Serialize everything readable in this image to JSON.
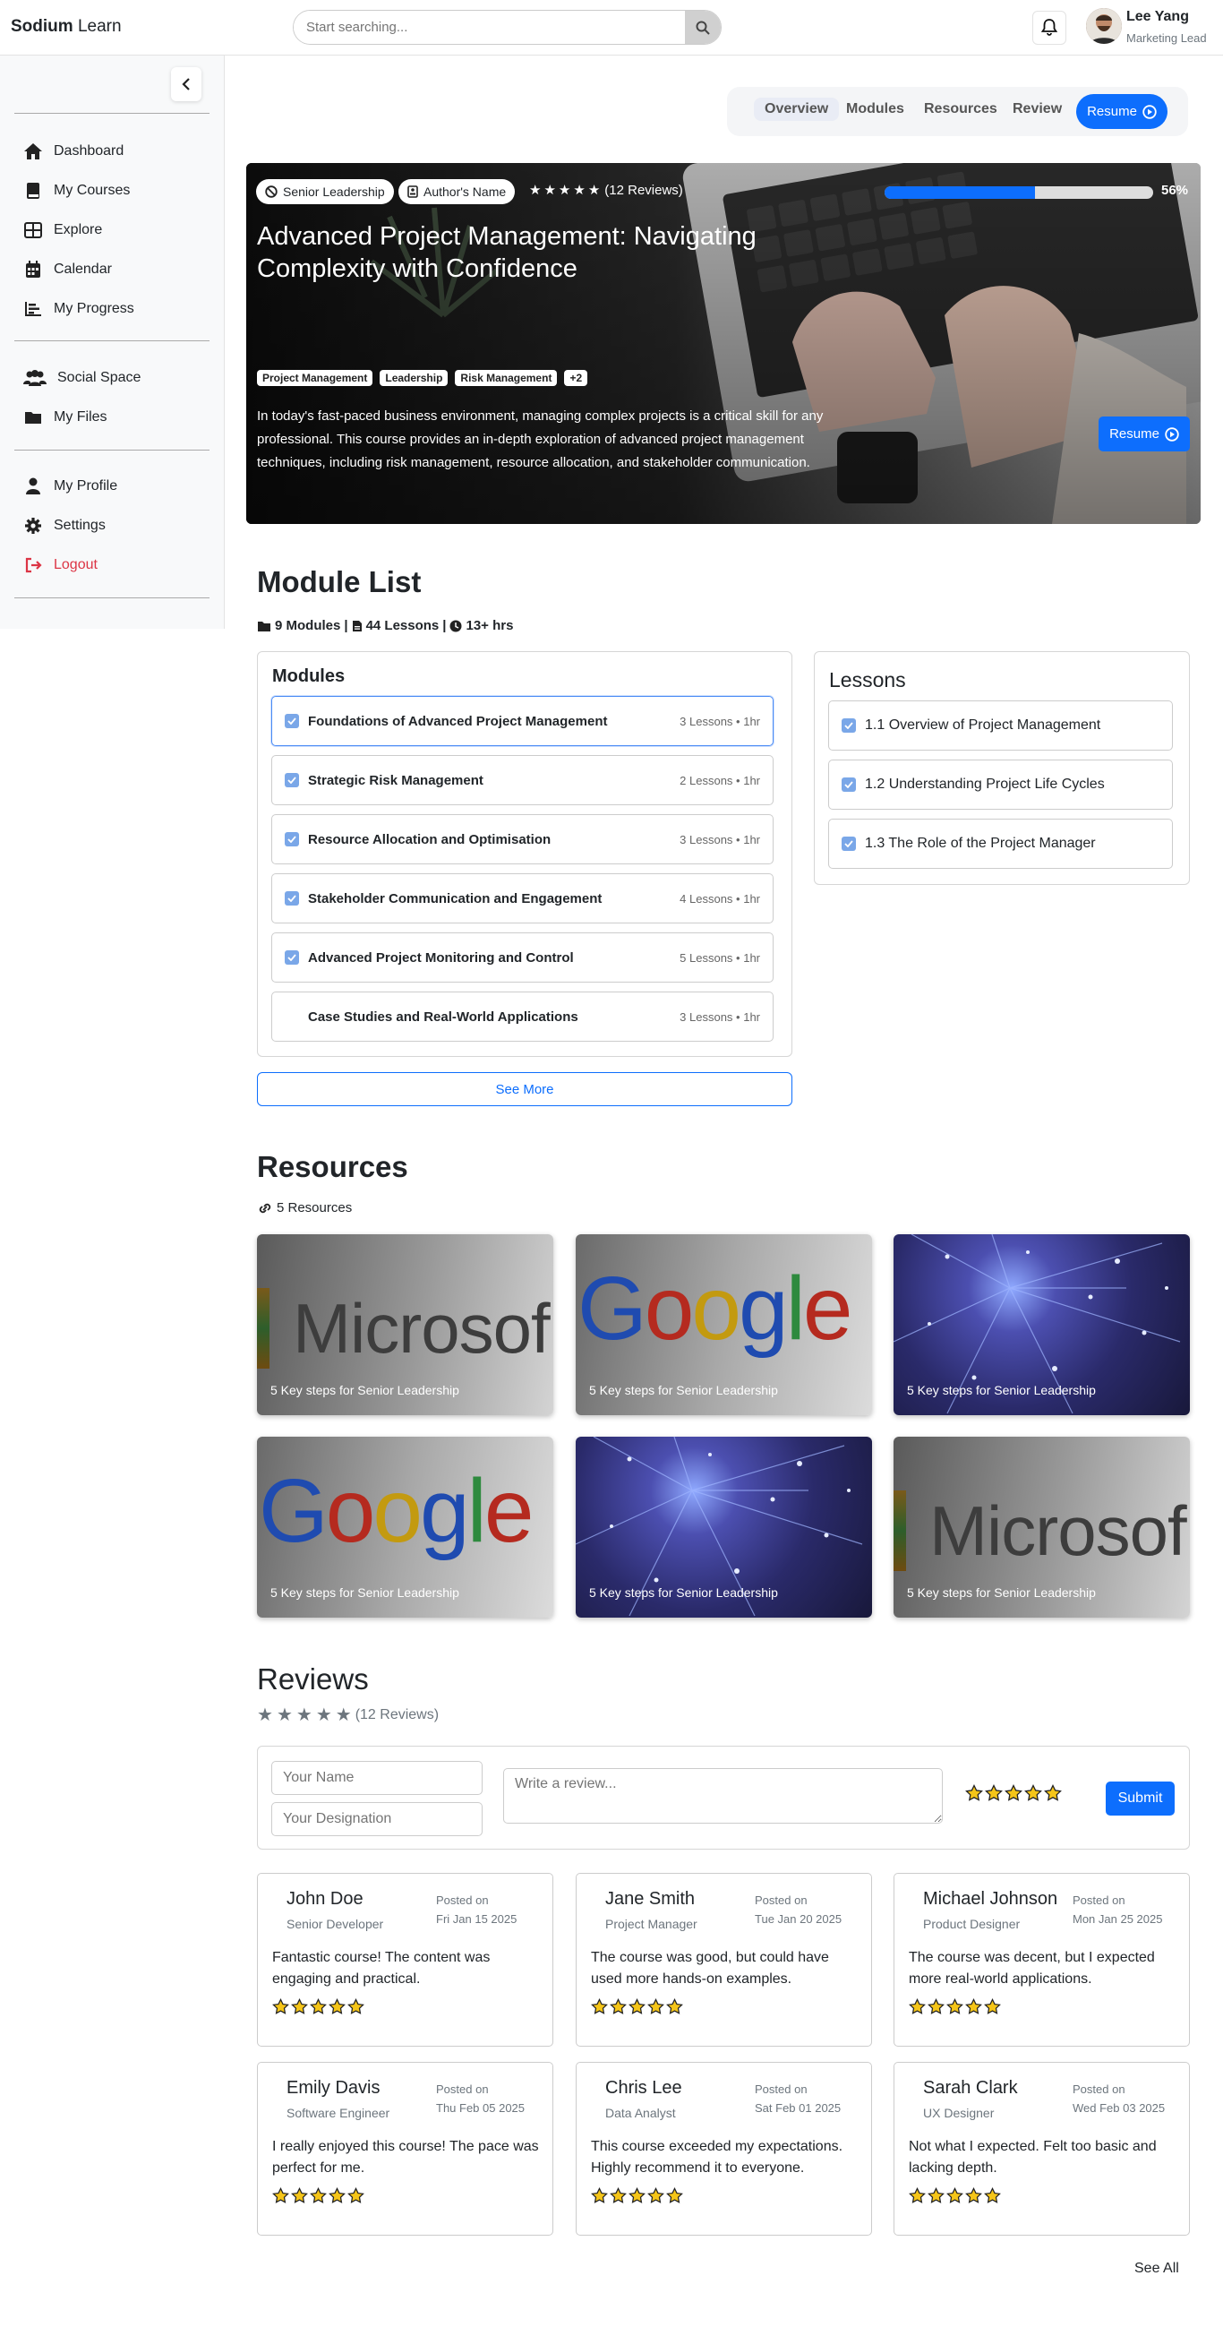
{
  "app": {
    "brand_bold": "Sodium",
    "brand_rest": " Learn"
  },
  "search": {
    "placeholder": "Start searching..."
  },
  "user": {
    "name": "Lee Yang",
    "role": "Marketing Lead"
  },
  "sidebar": {
    "group1": [
      {
        "label": "Dashboard",
        "icon": "home-icon"
      },
      {
        "label": "My Courses",
        "icon": "book-icon"
      },
      {
        "label": "Explore",
        "icon": "grid-icon"
      },
      {
        "label": "Calendar",
        "icon": "calendar-icon"
      },
      {
        "label": "My Progress",
        "icon": "chart-icon"
      }
    ],
    "group2": [
      {
        "label": "Social Space",
        "icon": "users-icon"
      },
      {
        "label": "My Files",
        "icon": "folder-icon"
      }
    ],
    "group3": [
      {
        "label": "My Profile",
        "icon": "user-icon"
      },
      {
        "label": "Settings",
        "icon": "gear-icon"
      },
      {
        "label": "Logout",
        "icon": "logout-icon"
      }
    ]
  },
  "tabs": {
    "overview": "Overview",
    "modules": "Modules",
    "resources": "Resources",
    "review": "Review",
    "resume": "Resume"
  },
  "hero": {
    "chip1": "Senior Leadership",
    "chip2": "Author's Name",
    "reviews": "(12 Reviews)",
    "progress_pct": "56%",
    "progress_value": 0.56,
    "title": "Advanced Project Management: Navigating Complexity with Confidence",
    "tags": [
      "Project Management",
      "Leadership",
      "Risk Management",
      "+2"
    ],
    "description": "In today's fast-paced business environment, managing complex projects is a critical skill for any professional. This course provides an in-depth exploration of advanced project management techniques, including risk management, resource allocation, and stakeholder communication.",
    "resume": "Resume"
  },
  "modules": {
    "heading": "Module List",
    "meta_modules": "9 Modules",
    "meta_lessons": "44 Lessons",
    "meta_hours": "13+ hrs",
    "card_title": "Modules",
    "items": [
      {
        "title": "Foundations of Advanced Project Management",
        "count": "3 Lessons • 1hr"
      },
      {
        "title": "Strategic Risk Management",
        "count": "2 Lessons • 1hr"
      },
      {
        "title": "Resource Allocation and Optimisation",
        "count": "3 Lessons • 1hr"
      },
      {
        "title": "Stakeholder Communication and Engagement",
        "count": "4 Lessons • 1hr"
      },
      {
        "title": "Advanced Project Monitoring and Control",
        "count": "5 Lessons • 1hr"
      },
      {
        "title": "Case Studies and Real-World Applications",
        "count": "3 Lessons • 1hr"
      }
    ],
    "see_more": "See More",
    "lessons_title": "Lessons",
    "lessons": [
      "1.1 Overview of Project Management",
      "1.2 Understanding Project Life Cycles",
      "1.3 The Role of the Project Manager"
    ]
  },
  "resources": {
    "heading": "Resources",
    "count": "5 Resources",
    "items": [
      {
        "label": "5 Key steps for Senior Leadership",
        "kind": "microsoft",
        "logo": "Microsof"
      },
      {
        "label": "5 Key steps for Senior Leadership",
        "kind": "google",
        "logo": "Google"
      },
      {
        "label": "5 Key steps for Senior Leadership",
        "kind": "fiber"
      },
      {
        "label": "5 Key steps for Senior Leadership",
        "kind": "google",
        "logo": "Google"
      },
      {
        "label": "5 Key steps for Senior Leadership",
        "kind": "fiber"
      },
      {
        "label": "5 Key steps for Senior Leadership",
        "kind": "microsoft",
        "logo": "Microsof"
      }
    ]
  },
  "reviews": {
    "heading": "Reviews",
    "count": "(12 Reviews)",
    "name_placeholder": "Your Name",
    "designation_placeholder": "Your Designation",
    "review_placeholder": "Write a review...",
    "submit": "Submit",
    "posted_on": "Posted on",
    "items": [
      {
        "name": "John Doe",
        "designation": "Senior Developer",
        "date": "Fri Jan 15 2025",
        "text": "Fantastic course! The content was engaging and practical."
      },
      {
        "name": "Jane Smith",
        "designation": "Project Manager",
        "date": "Tue Jan 20 2025",
        "text": "The course was good, but could have used more hands-on examples."
      },
      {
        "name": "Michael Johnson",
        "designation": "Product Designer",
        "date": "Mon Jan 25 2025",
        "text": "The course was decent, but I expected more real-world applications."
      },
      {
        "name": "Emily Davis",
        "designation": "Software Engineer",
        "date": "Thu Feb 05 2025",
        "text": "I really enjoyed this course! The pace was perfect for me."
      },
      {
        "name": "Chris Lee",
        "designation": "Data Analyst",
        "date": "Sat Feb 01 2025",
        "text": "This course exceeded my expectations. Highly recommend it to everyone."
      },
      {
        "name": "Sarah Clark",
        "designation": "UX Designer",
        "date": "Wed Feb 03 2025",
        "text": "Not what I expected. Felt too basic and lacking depth."
      }
    ],
    "see_all": "See All"
  },
  "colors": {
    "accent": "#0d6efd",
    "logout": "#dc3545",
    "star": "#f5c518"
  }
}
